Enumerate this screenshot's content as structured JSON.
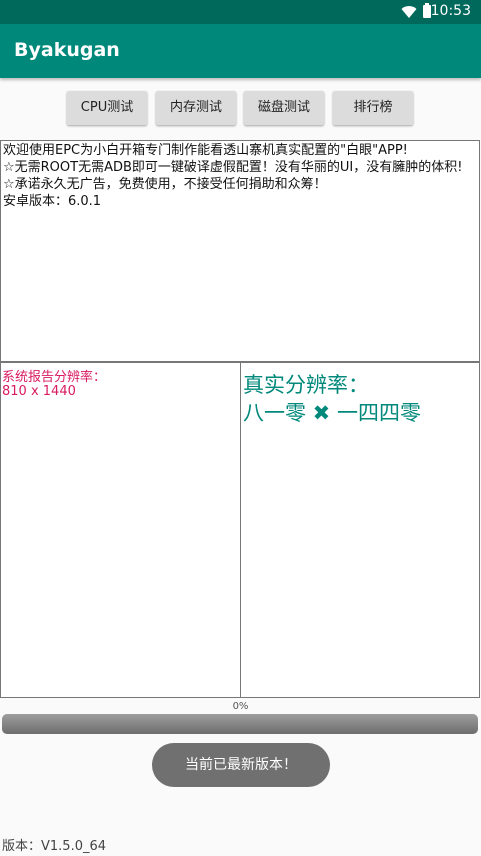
{
  "status_bar": {
    "time": "10:53",
    "icons": [
      "wifi-icon",
      "battery-icon"
    ]
  },
  "app_bar": {
    "title": "Byakugan"
  },
  "toolbar": {
    "cpu_label": "CPU测试",
    "memory_label": "内存测试",
    "disk_label": "磁盘测试",
    "ranking_label": "排行榜"
  },
  "info": {
    "lines": [
      "欢迎使用EPC为小白开箱专门制作能看透山寨机真实配置的\"白眼\"APP!",
      "☆无需ROOT无需ADB即可一键破译虚假配置！没有华丽的UI，没有臃肿的体积!",
      "☆承诺永久无广告，免费使用，不接受任何捐助和众筹！",
      "安卓版本：6.0.1"
    ]
  },
  "reported": {
    "label": "系统报告分辨率：",
    "value": "810 x 1440"
  },
  "real": {
    "label": "真实分辨率：",
    "value": "八一零 ✖ 一四四零"
  },
  "progress": {
    "text": "0%",
    "value": 0
  },
  "toast": {
    "text": "当前已最新版本！"
  },
  "footer": {
    "version": "版本：V1.5.0_64"
  },
  "colors": {
    "primary": "#00897b",
    "status_bar": "#00695c",
    "reported_text": "#d81b60",
    "real_text": "#00897b"
  }
}
